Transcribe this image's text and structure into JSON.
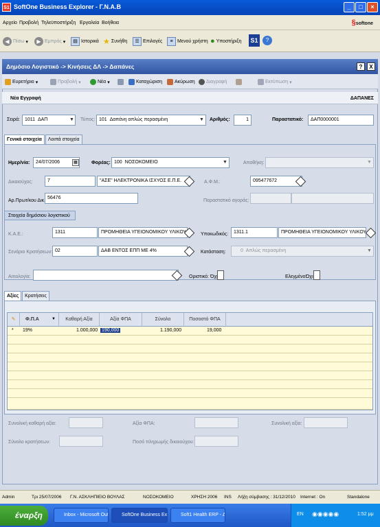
{
  "window": {
    "title": "SoftOne Business Explorer - Γ.Ν.Α.Β",
    "icon_text": "S1"
  },
  "menu": [
    "Αρχείο",
    "Προβολή",
    "Τηλεϋποστήριξη",
    "Εργαλεία",
    "Βοήθεια"
  ],
  "brand": {
    "logo_prefix": "§",
    "logo_text": "softone"
  },
  "nav": {
    "back": "Πίσω",
    "forward": "Εμπρός",
    "history": "Ιστορικά",
    "favorites": "Συνήθη",
    "options": "Επιλογές",
    "user_menu": "Μενού χρήστη",
    "support": "Υποστήριξη",
    "s1": "S1"
  },
  "form": {
    "title": "Δημόσιο Λογιστικό -> Κινήσεις ΔΛ -> Δαπάνες",
    "help": "?",
    "close": "X"
  },
  "toolbar": {
    "finder": "Ευρετήριο",
    "view": "Προβολή",
    "new": "Νέα",
    "save": "Καταχώριση",
    "cancel": "Ακύρωση",
    "delete": "Διαγραφή",
    "print": "Εκτύπωση"
  },
  "record": {
    "status": "Νέα Εγγραφή",
    "module": "ΔΑΠΑΝΕΣ"
  },
  "header_fields": {
    "series_label": "Σειρά:",
    "series_code": "1011",
    "series_value": "ΔΑΠ",
    "type_label": "Τύπος:",
    "type_code": "101",
    "type_value": "Δαπάνη απλώς περασμένη",
    "number_label": "Αριθμός:",
    "number_value": "1",
    "doc_label": "Παραστατικό:",
    "doc_value": "ΔΑΠ0000001"
  },
  "tabs_main": [
    "Γενικά στοιχεία",
    "Λοιπά στοιχεία"
  ],
  "general": {
    "date_label": "Ημερ/νία:",
    "date_value": "24/07/2006",
    "agency_label": "Φορέας:",
    "agency_code": "100",
    "agency_value": "ΝΟΣΟΚΟΜΕΙΟ",
    "warehouse_label": "Αποθήκη:",
    "beneficiary_label": "Δικαιούχος:",
    "beneficiary_code": "7",
    "beneficiary_value": "\"ΑΣΕ\" ΗΛΕΚΤΡΟΝΙΚΑ ΙΣΧΥΟΣ Ε.Π.Ε.",
    "afm_label": "Α.Φ.Μ.:",
    "afm_value": "095477672",
    "protocol_label": "Αρ.Πρωτ/κου Δικ.:",
    "protocol_value": "56476",
    "purchase_doc_label": "Παραστατικό αγοράς:"
  },
  "public": {
    "section_label": "Στοιχεία δημόσιου λογιστικού",
    "kae_label": "Κ.Α.Ε.:",
    "kae_code": "1311",
    "kae_value": "ΠΡΟΜΗΘΕΙΑ ΥΓΕΙΟΝΟΜΙΚΟΥ ΥΛΙΚΟΥ",
    "subcode_label": "Υποκωδικός:",
    "subcode_code": "1311.1",
    "subcode_value": "ΠΡΟΜΗΘΕΙΑ ΥΓΕΙΟΝΟΜΙΚΟΥ ΥΛΙΚΟΥ",
    "scenario_label": "Σενάριο Κρατήσεων:",
    "scenario_code": "02",
    "scenario_value": "ΔΑΒ ΕΝΤΟΣ ΕΠΠ ΜΕ 4%",
    "state_label": "Κατάσταση:",
    "state_code": "0",
    "state_value": "Απλώς περασμένη",
    "justification_label": "Αιτιολογία:",
    "final_label": "Οριστικό:",
    "final_value": "Όχι",
    "checked_label": "Ελεγμένο:",
    "checked_value": "Όχι"
  },
  "tabs_sub": [
    "Αξίες",
    "Κρατήσεις"
  ],
  "grid": {
    "columns": [
      "Φ.Π.Α",
      "Καθαρή Αξία",
      "Αξία ΦΠΑ",
      "Σύνολο",
      "Ποσοστό ΦΠΑ"
    ],
    "rows": [
      {
        "marker": "*",
        "vat": "19%",
        "net": "1.000,000",
        "vat_value": "190,000",
        "total": "1.190,000",
        "percent": "19,000"
      }
    ]
  },
  "totals": {
    "net_label": "Συνολική καθαρή αξία:",
    "vat_label": "Αξία ΦΠΑ:",
    "total_label": "Συνολική αξία:",
    "deductions_label": "Σύνολο κρατήσεων:",
    "payable_label": "Ποσό πληρωμής δικαιούχου:"
  },
  "status": {
    "user": "Admin",
    "date": "Τρι 25/07/2006",
    "org": "Γ.Ν. ΑΣΚΛΗΠΙΕΙΟ ΒΟΥΛΑΣ",
    "branch": "ΝΟΣΟΚΟΜΕΙΟ",
    "year": "ΧΡΗΣΗ 2006",
    "ins": "INS",
    "expiry": "Λήξη σύμβασης : 31/12/2010",
    "internet": "Internet : On",
    "mode": "Standalone"
  },
  "taskbar": {
    "start": "έναρξη",
    "items": [
      "Inbox - Microsoft Out...",
      "SoftOne Business Ex...",
      "Soft1 Health ERP - Δ..."
    ],
    "lang": "EN",
    "clock": "1:52 μμ"
  }
}
